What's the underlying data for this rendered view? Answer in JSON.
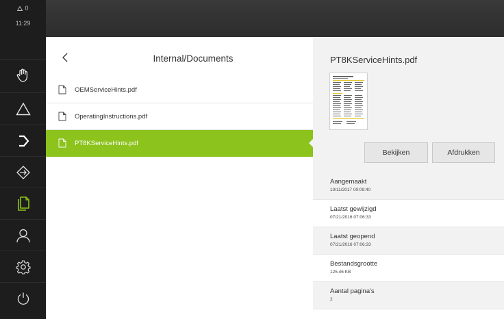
{
  "status": {
    "warnings": "0",
    "time": "11:29"
  },
  "sidebar": {
    "items": [
      {
        "name": "manual-mode"
      },
      {
        "name": "mdi-mode"
      },
      {
        "name": "program-run"
      },
      {
        "name": "programming"
      },
      {
        "name": "file-management",
        "active": true
      },
      {
        "name": "user-login"
      },
      {
        "name": "settings"
      },
      {
        "name": "power"
      }
    ],
    "active_color": "#8cc31c"
  },
  "list": {
    "path": "Internal/Documents",
    "files": [
      {
        "name": "OEMServiceHints.pdf",
        "selected": false
      },
      {
        "name": "OperatingInstructions.pdf",
        "selected": false
      },
      {
        "name": "PT8KServiceHints.pdf",
        "selected": true
      }
    ]
  },
  "details": {
    "title": "PT8KServiceHints.pdf",
    "buttons": {
      "view": "Bekijken",
      "print": "Afdrukken"
    },
    "properties": [
      {
        "label": "Aangemaakt",
        "value": "10/11/2017 00:09:40"
      },
      {
        "label": "Laatst gewijzigd",
        "value": "07/21/2016 07:06:33"
      },
      {
        "label": "Laatst geopend",
        "value": "07/21/2016 07:06:33"
      },
      {
        "label": "Bestandsgrootte",
        "value": "125.46 KB"
      },
      {
        "label": "Aantal pagina's",
        "value": "2"
      }
    ]
  },
  "colors": {
    "accent": "#8cc31c",
    "sidebar": "#1d1d1d",
    "topbar": "#333333"
  }
}
